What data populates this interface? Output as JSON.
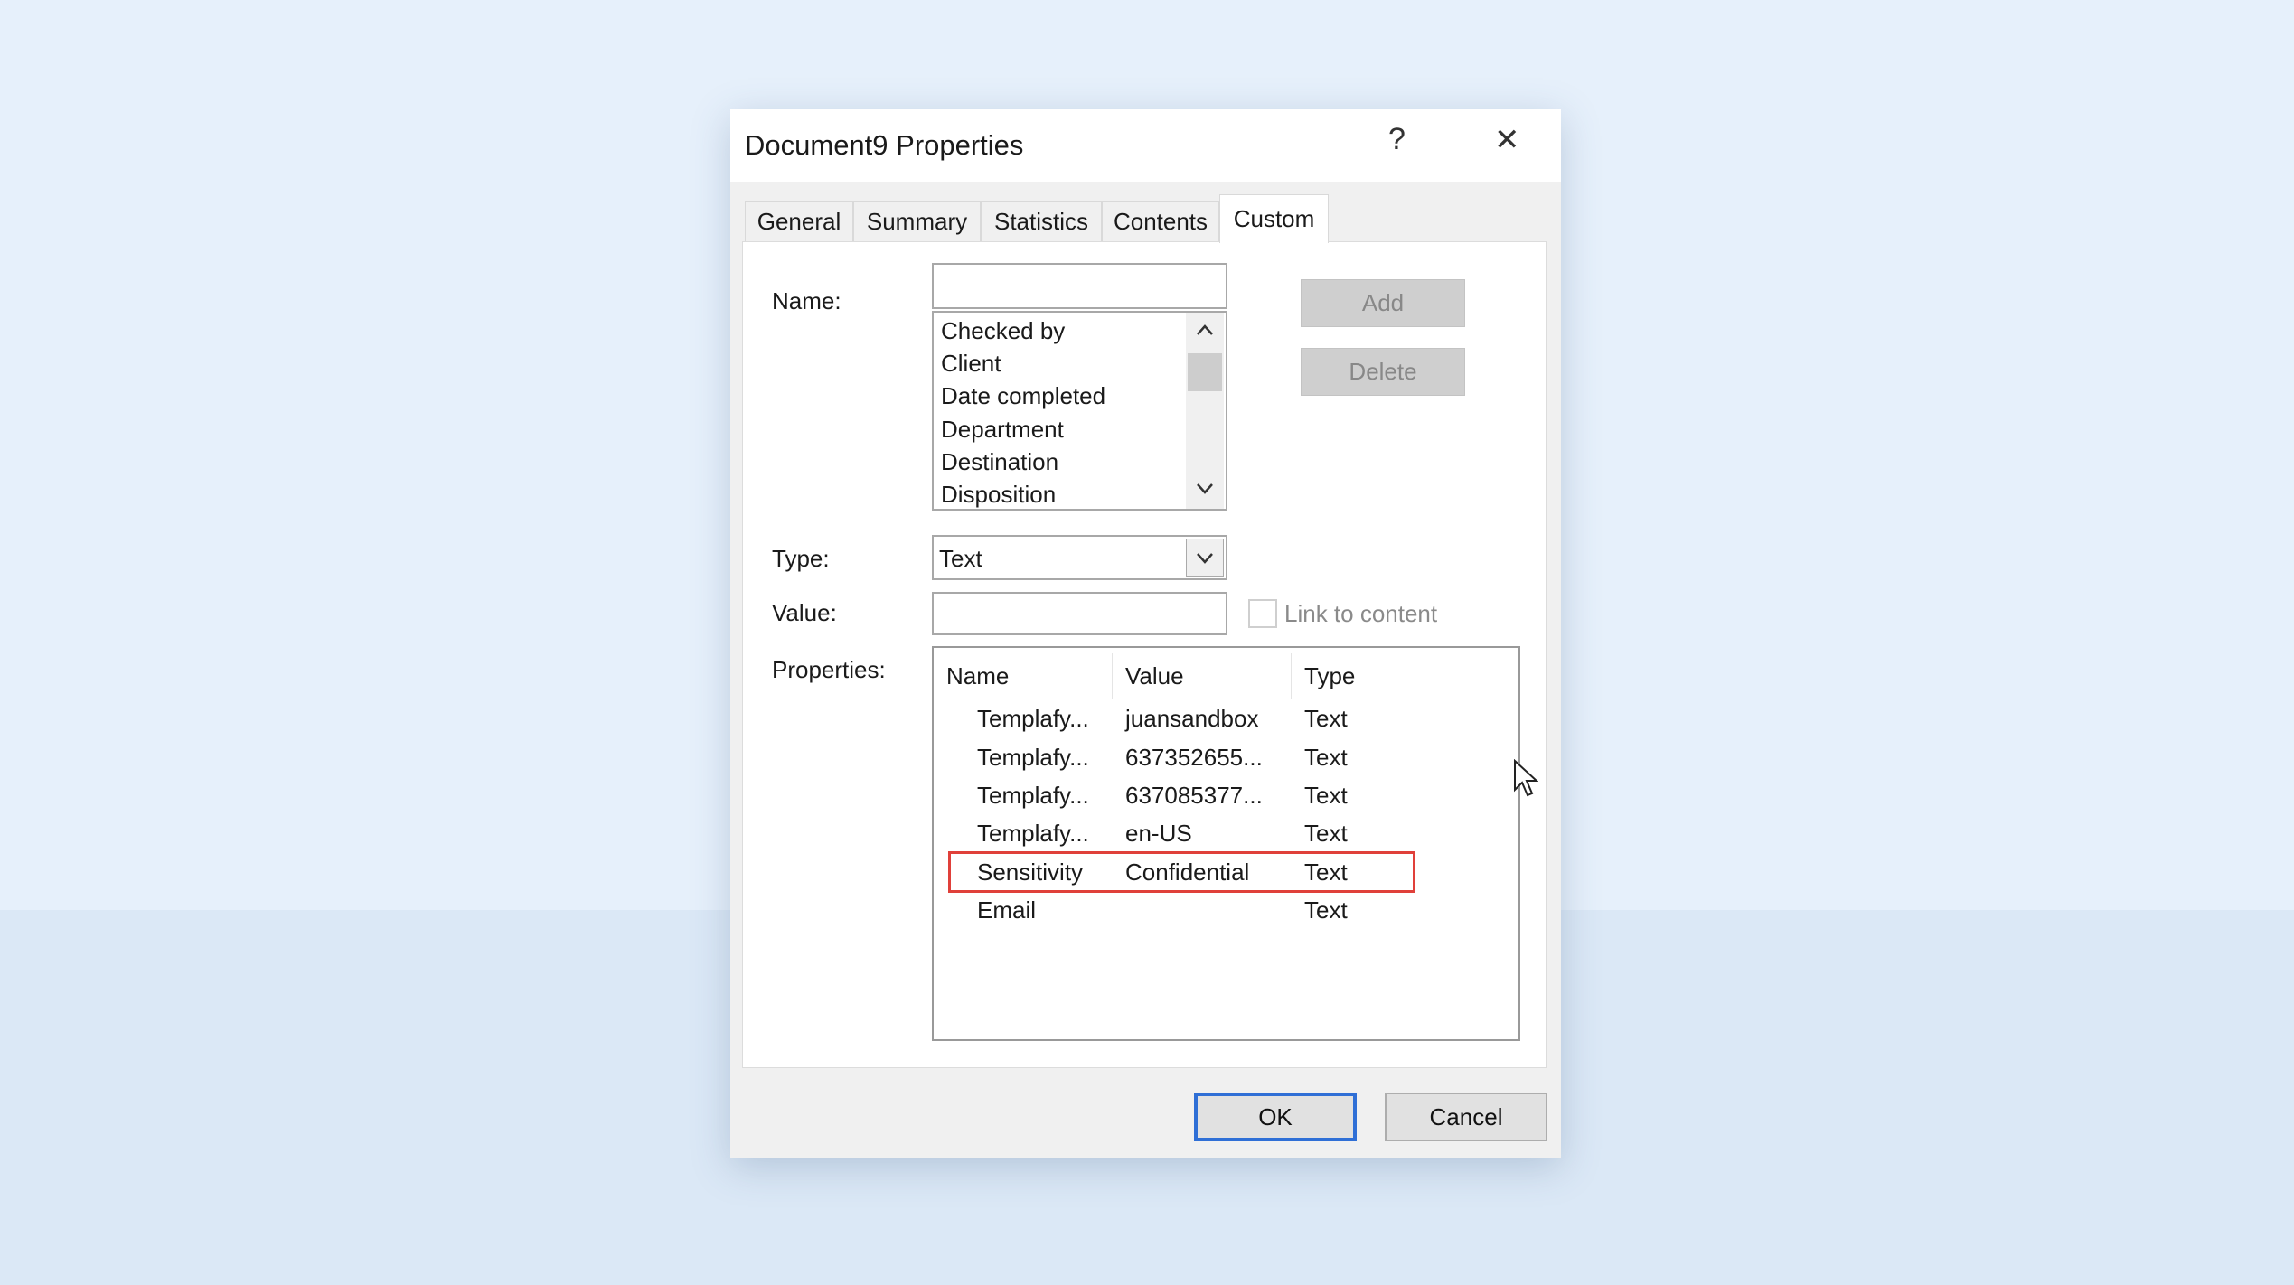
{
  "dialog": {
    "title": "Document9 Properties",
    "help_label": "?",
    "close_label": "✕",
    "tabs": [
      {
        "label": "General"
      },
      {
        "label": "Summary"
      },
      {
        "label": "Statistics"
      },
      {
        "label": "Contents"
      },
      {
        "label": "Custom",
        "active": true
      }
    ]
  },
  "custom": {
    "name_label": "Name:",
    "name_value": "",
    "name_options": [
      "Checked by",
      "Client",
      "Date completed",
      "Department",
      "Destination",
      "Disposition"
    ],
    "add_label": "Add",
    "delete_label": "Delete",
    "type_label": "Type:",
    "type_value": "Text",
    "value_label": "Value:",
    "value_value": "",
    "link_label": "Link to content",
    "link_checked": false,
    "properties_label": "Properties:",
    "columns": [
      "Name",
      "Value",
      "Type"
    ],
    "rows": [
      {
        "name": "Templafy...",
        "value": "juansandbox",
        "type": "Text"
      },
      {
        "name": "Templafy...",
        "value": "637352655...",
        "type": "Text"
      },
      {
        "name": "Templafy...",
        "value": "637085377...",
        "type": "Text"
      },
      {
        "name": "Templafy...",
        "value": "en-US",
        "type": "Text"
      },
      {
        "name": "Sensitivity",
        "value": "Confidential",
        "type": "Text",
        "highlighted": true
      },
      {
        "name": "Email",
        "value": "",
        "type": "Text"
      }
    ],
    "highlight_color": "#e0403a"
  },
  "footer": {
    "ok_label": "OK",
    "cancel_label": "Cancel",
    "ok_border_color": "#2f6fd6"
  }
}
